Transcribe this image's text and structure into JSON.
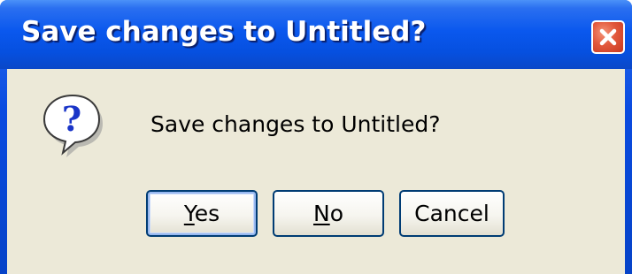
{
  "window": {
    "title": "Save changes to Untitled?",
    "close_icon": "close-icon"
  },
  "dialog": {
    "icon": "question-icon",
    "message": "Save changes to Untitled?",
    "buttons": [
      {
        "first": "Y",
        "rest": "es",
        "default": true
      },
      {
        "first": "N",
        "rest": "o",
        "default": false
      },
      {
        "label": "Cancel",
        "default": false
      }
    ]
  },
  "colors": {
    "titlebar": "#0a58ee",
    "client": "#ece9d8",
    "close_button": "#e2583c",
    "button_border": "#003c74"
  }
}
